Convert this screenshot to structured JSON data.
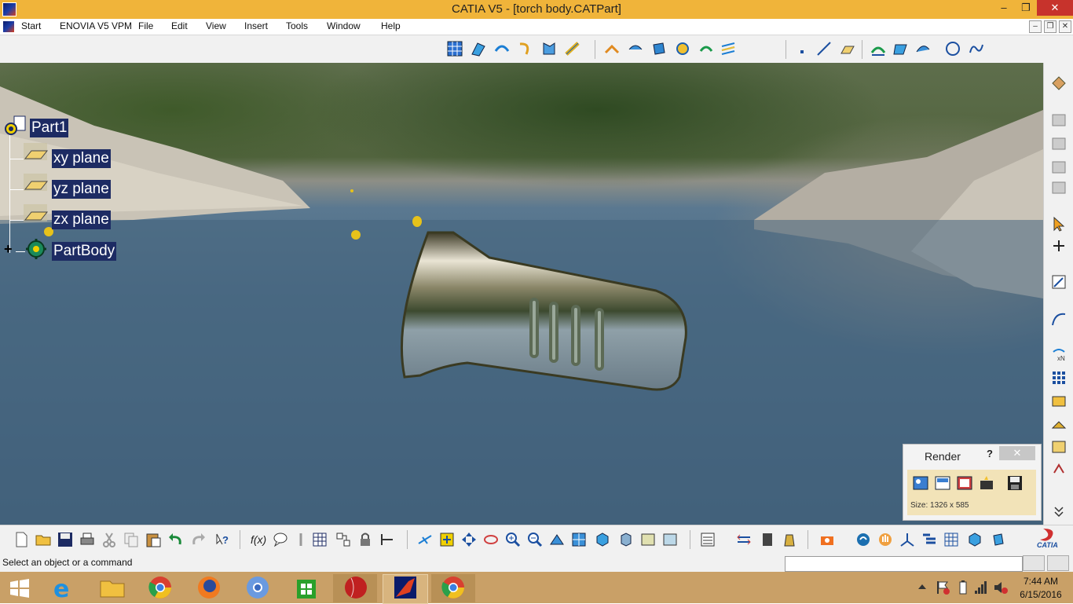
{
  "window": {
    "title": "CATIA V5 - [torch body.CATPart]",
    "minimize": "–",
    "restore": "❐",
    "close": "✕"
  },
  "menubar": {
    "items": [
      "Start",
      "ENOVIA V5 VPM",
      "File",
      "Edit",
      "View",
      "Insert",
      "Tools",
      "Window",
      "Help"
    ],
    "doc_controls": [
      "–",
      "❐",
      "✕"
    ]
  },
  "spec_tree": {
    "root": "Part1",
    "children": [
      "xy plane",
      "yz plane",
      "zx plane",
      "PartBody"
    ],
    "expand_symbol": "+"
  },
  "render_panel": {
    "title": "Render",
    "help": "?",
    "close": "✕",
    "size_label": "Size: 1326 x 585"
  },
  "status": {
    "message": "Select an object or a command",
    "command_input": ""
  },
  "taskbar": {
    "time": "7:44 AM",
    "date": "6/15/2016"
  },
  "brand": {
    "logo_text": "CATIA"
  },
  "colors": {
    "titlebar": "#f0b43a",
    "tree_node_bg": "#1d2b63",
    "taskbar": "#c9a067",
    "close_red": "#c7332c"
  }
}
